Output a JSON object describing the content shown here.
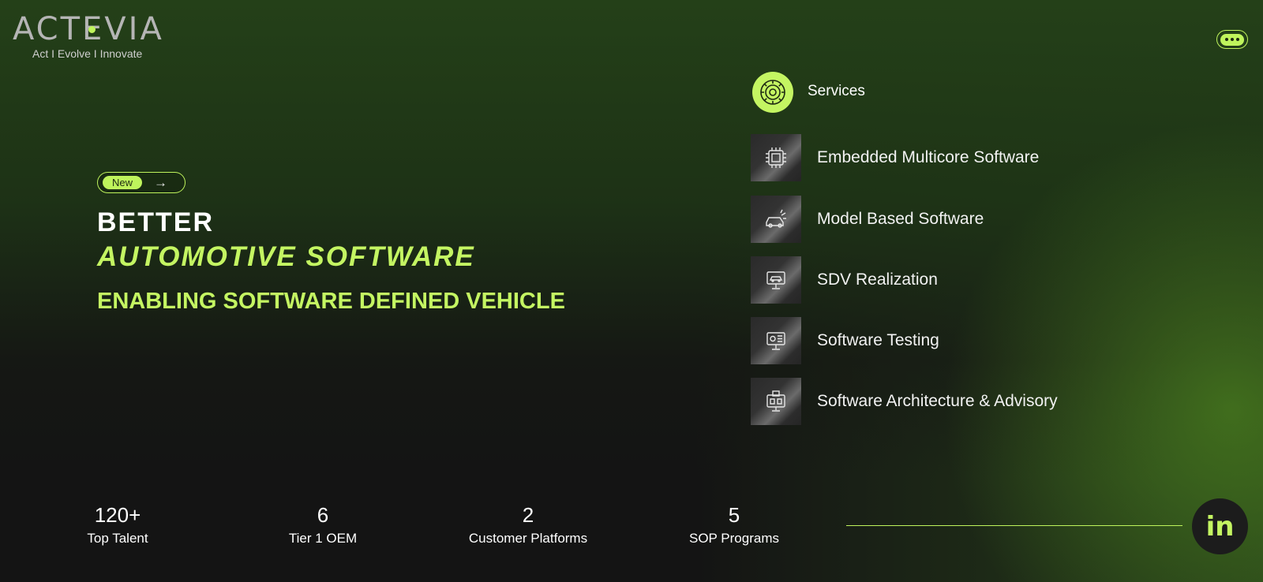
{
  "brand": {
    "logo": "ACTEVIA",
    "tagline": "Act I Evolve I Innovate",
    "accent_color": "#c4f562"
  },
  "header": {
    "menu_icon": "more-dots-icon"
  },
  "hero": {
    "badge_label": "New",
    "badge_arrow": "→",
    "line1": "BETTER",
    "line2": "AUTOMOTIVE SOFTWARE",
    "subtitle": "ENABLING SOFTWARE DEFINED VEHICLE"
  },
  "services": {
    "label": "Services",
    "items": [
      {
        "label": "Embedded Multicore Software",
        "icon": "chip-icon"
      },
      {
        "label": "Model Based Software",
        "icon": "car-icon"
      },
      {
        "label": "SDV Realization",
        "icon": "vehicle-monitor-icon"
      },
      {
        "label": "Software Testing",
        "icon": "monitor-gear-icon"
      },
      {
        "label": "Software Architecture & Advisory",
        "icon": "monitor-architecture-icon"
      }
    ]
  },
  "stats": [
    {
      "value": "120+",
      "label": "Top Talent"
    },
    {
      "value": "6",
      "label": "Tier 1 OEM"
    },
    {
      "value": "2",
      "label": "Customer Platforms"
    },
    {
      "value": "5",
      "label": "SOP Programs"
    }
  ],
  "social": {
    "linkedin_text": "in"
  }
}
